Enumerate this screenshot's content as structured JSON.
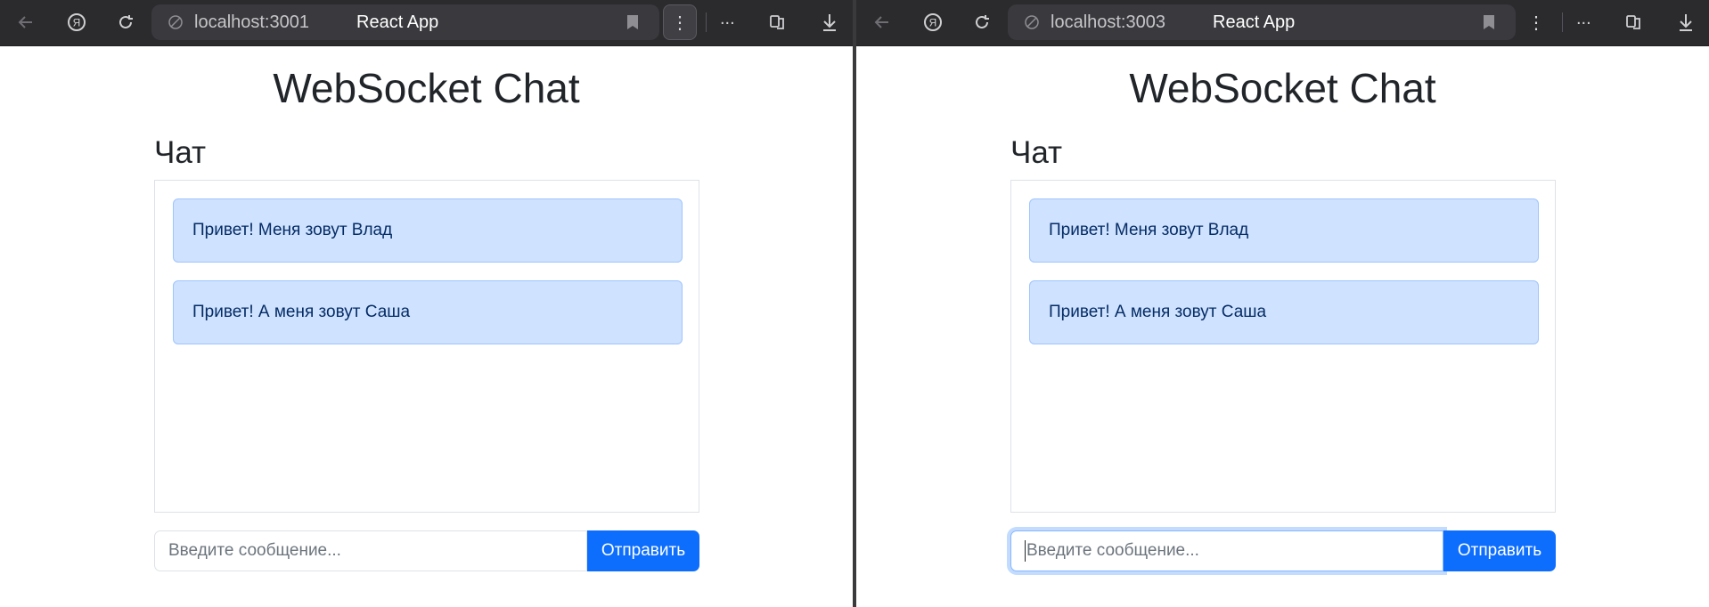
{
  "windows": [
    {
      "url": "localhost:3001",
      "page_title": "React App",
      "heading": "WebSocket Chat",
      "chat_title": "Чат",
      "messages": [
        "Привет! Меня зовут Влад",
        "Привет! А меня зовут Саша"
      ],
      "input_placeholder": "Введите сообщение...",
      "send_label": "Отправить",
      "menu_glyph": "⋮",
      "more_glyph": "..."
    },
    {
      "url": "localhost:3003",
      "page_title": "React App",
      "heading": "WebSocket Chat",
      "chat_title": "Чат",
      "messages": [
        "Привет! Меня зовут Влад",
        "Привет! А меня зовут Саша"
      ],
      "input_placeholder": "Введите сообщение...",
      "send_label": "Отправить",
      "menu_glyph": "⋮",
      "more_glyph": "..."
    }
  ],
  "colors": {
    "accent": "#0d6efd",
    "message_bg": "#cfe2ff",
    "message_border": "#9ec5fe",
    "message_text": "#052c65",
    "toolbar_bg": "#2b2b2e"
  },
  "icons": [
    "back-arrow-icon",
    "yandex-icon",
    "reload-icon",
    "site-info-icon",
    "bookmark-icon",
    "menu-icon",
    "extensions-icon",
    "download-icon"
  ]
}
